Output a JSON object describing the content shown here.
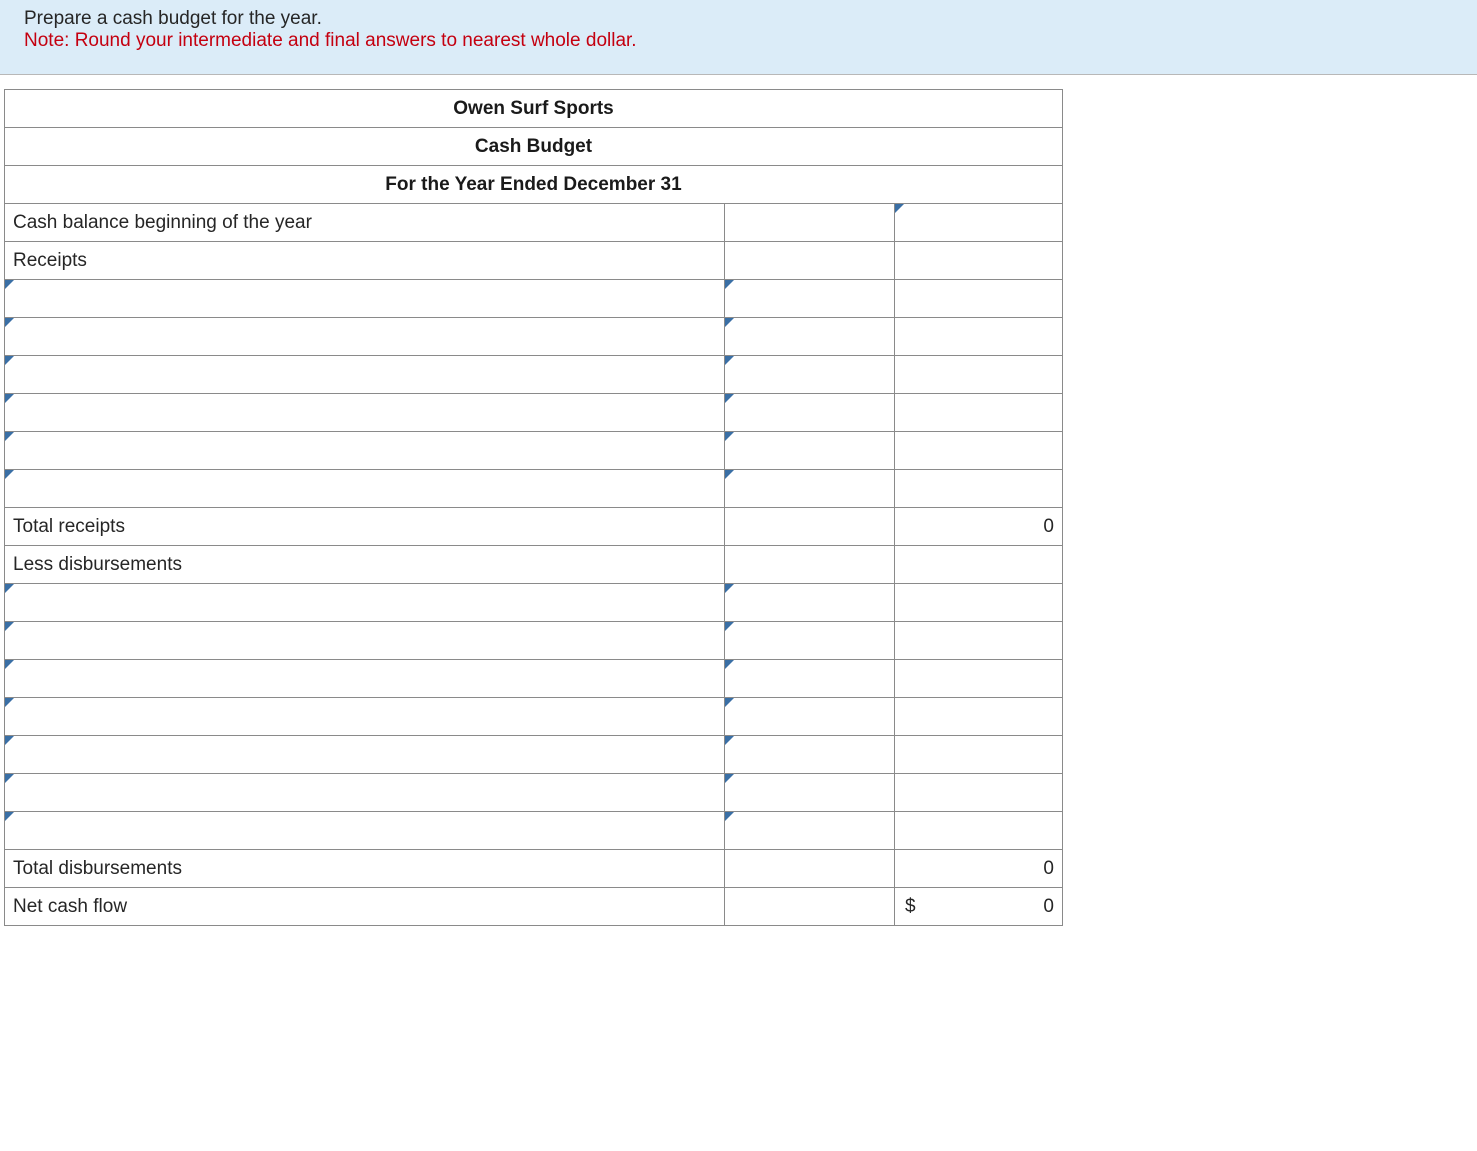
{
  "instructions": {
    "line1": "Prepare a cash budget for the year.",
    "line2": "Note: Round your intermediate and final answers to nearest whole dollar."
  },
  "header": {
    "company": "Owen Surf Sports",
    "title": "Cash Budget",
    "period": "For the Year Ended December 31"
  },
  "rows": {
    "cash_balance_beg": "Cash balance beginning of the year",
    "receipts_label": "Receipts",
    "total_receipts_label": "Total receipts",
    "total_receipts_value": "0",
    "less_disb_label": "Less disbursements",
    "total_disb_label": "Total disbursements",
    "total_disb_value": "0",
    "net_cash_label": "Net cash flow",
    "net_cash_currency": "$",
    "net_cash_value": "0"
  }
}
